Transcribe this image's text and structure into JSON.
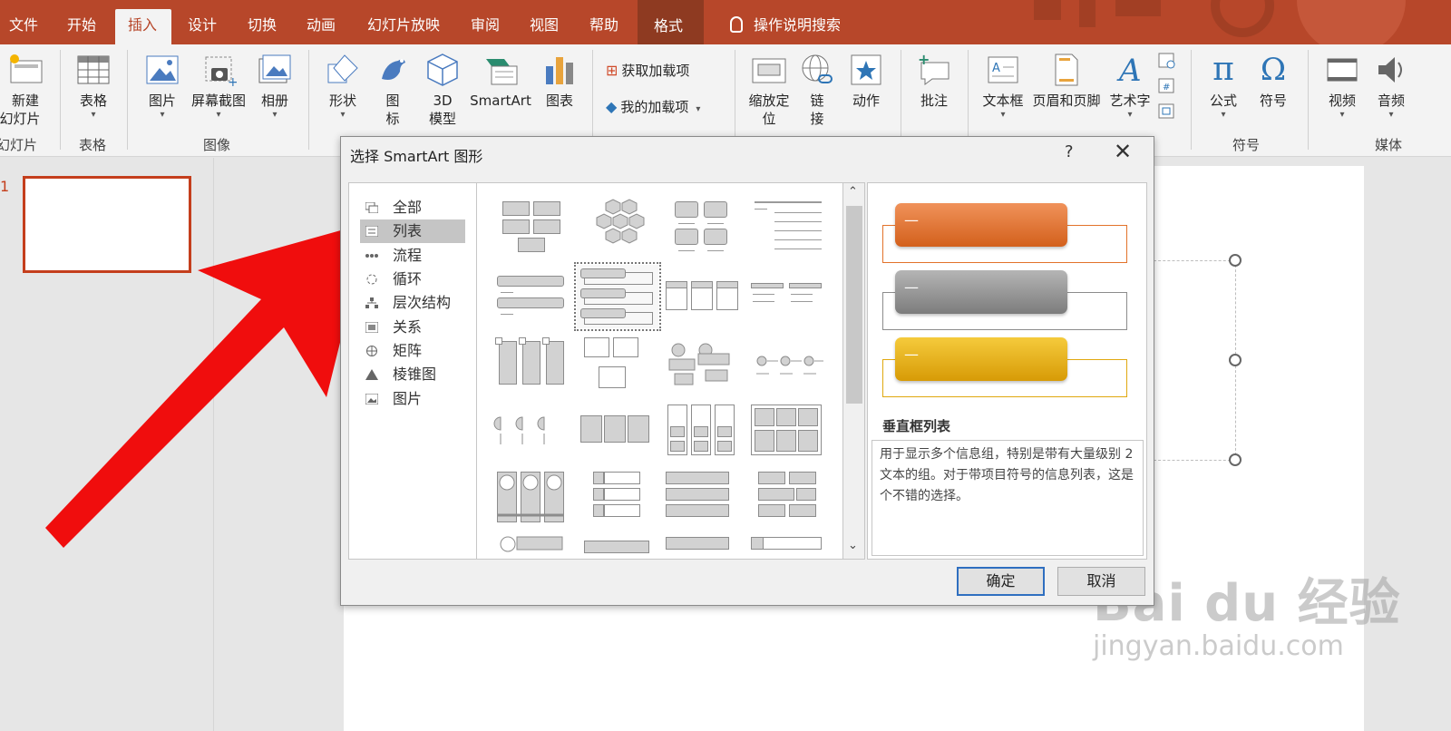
{
  "tabs": [
    {
      "label": "文件"
    },
    {
      "label": "开始"
    },
    {
      "label": "插入"
    },
    {
      "label": "设计"
    },
    {
      "label": "切换"
    },
    {
      "label": "动画"
    },
    {
      "label": "幻灯片放映"
    },
    {
      "label": "审阅"
    },
    {
      "label": "视图"
    },
    {
      "label": "帮助"
    },
    {
      "label": "格式"
    }
  ],
  "active_tab": "插入",
  "search_label": "操作说明搜索",
  "ribbon": {
    "new_slide": {
      "line1": "新建",
      "line2": "幻灯片"
    },
    "table": "表格",
    "picture": "图片",
    "screenshot": "屏幕截图",
    "album": "相册",
    "shapes": "形状",
    "icons": {
      "line1": "图",
      "line2": "标"
    },
    "model3d": {
      "line1": "3D",
      "line2": "模型"
    },
    "smartart": "SmartArt",
    "chart": "图表",
    "get_addins": "获取加载项",
    "my_addins": "我的加载项",
    "zoom": {
      "line1": "缩放定",
      "line2": "位"
    },
    "link": {
      "line1": "链",
      "line2": "接"
    },
    "action": "动作",
    "comment": "批注",
    "textbox": "文本框",
    "header_footer": "页眉和页脚",
    "wordart": "艺术字",
    "equation": "公式",
    "symbol": "符号",
    "video": "视频",
    "audio": "音频",
    "groups": {
      "slides": "幻灯片",
      "tables": "表格",
      "images": "图像",
      "symbols": "符号",
      "media": "媒体"
    }
  },
  "slide_number": "1",
  "dialog": {
    "title": "选择 SmartArt 图形",
    "help": "?",
    "close": "✕",
    "categories": [
      {
        "label": "全部"
      },
      {
        "label": "列表"
      },
      {
        "label": "流程"
      },
      {
        "label": "循环"
      },
      {
        "label": "层次结构"
      },
      {
        "label": "关系"
      },
      {
        "label": "矩阵"
      },
      {
        "label": "棱锥图"
      },
      {
        "label": "图片"
      }
    ],
    "selected_category": "列表",
    "preview": {
      "bullet": "—",
      "colors": {
        "orange": "#e2722a",
        "gray": "#8c8c8c",
        "yellow": "#e0a80f"
      },
      "name": "垂直框列表",
      "description": "用于显示多个信息组，特别是带有大量级别 2 文本的组。对于带项目符号的信息列表，这是个不错的选择。"
    },
    "ok": "确定",
    "cancel": "取消"
  },
  "watermark": {
    "line1": "Bai du 经验",
    "line2": "jingyan.baidu.com"
  }
}
